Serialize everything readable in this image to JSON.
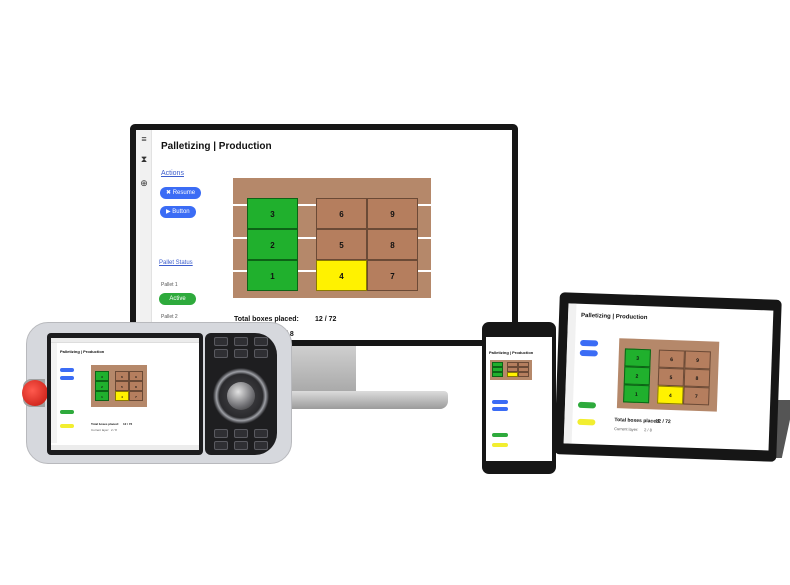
{
  "monitor": {
    "title": "Palletizing  |  Production",
    "actions_label": "Actions",
    "resume_label": "Resume",
    "button_label": "Button",
    "pallet_status_label": "Pallet Status",
    "pallet1_label": "Pallet 1",
    "active_label": "Active",
    "pallet2_label": "Pallet 2",
    "total_label": "Total boxes placed:",
    "total_value": "12 / 72",
    "layer_fragment": "/ 8",
    "sidebar_icons": [
      "≡",
      "⧗",
      "⊕"
    ]
  },
  "pallet_boxes": [
    {
      "num": "3",
      "color": "green"
    },
    {
      "num": "2",
      "color": "green"
    },
    {
      "num": "1",
      "color": "green"
    },
    {
      "num": "6",
      "color": "brown"
    },
    {
      "num": "5",
      "color": "brown"
    },
    {
      "num": "4",
      "color": "yellow"
    },
    {
      "num": "9",
      "color": "brown"
    },
    {
      "num": "8",
      "color": "brown"
    },
    {
      "num": "7",
      "color": "brown"
    }
  ],
  "pendant": {
    "title": "Palletizing  |  Production",
    "total_label": "Total boxes placed:",
    "total_value": "12 / 72",
    "layer_label": "Current layer:",
    "layer_value": "2 / 8"
  },
  "phone": {
    "title": "Palletizing  |  Production"
  },
  "tablet": {
    "title": "Palletizing  |  Production",
    "total_label": "Total boxes placed:",
    "total_value": "12 / 72",
    "layer_label": "Current layer:",
    "layer_value": "2 / 8"
  },
  "colors": {
    "pallet": "#b5886a",
    "green_box": "#20b02d",
    "brown_box": "#b57e5e",
    "yellow_box": "#fff200",
    "accent_blue": "#3b6cf5",
    "active_green": "#2eaa3c"
  }
}
